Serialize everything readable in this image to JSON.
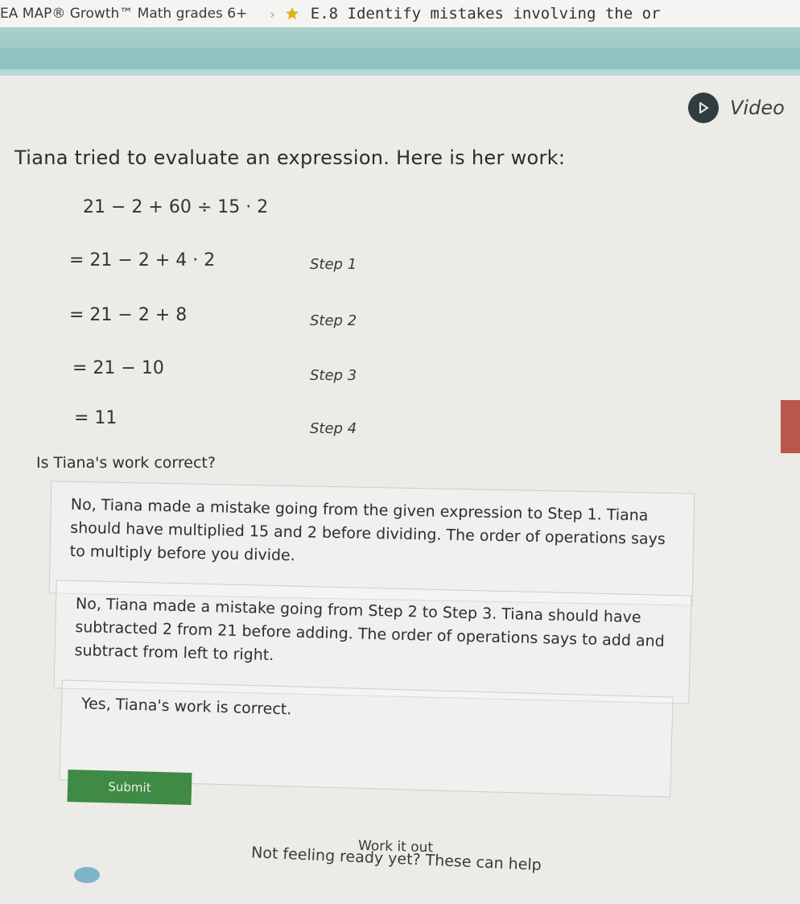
{
  "breadcrumb": {
    "item1": "EA MAP® Growth™ Math grades 6+",
    "separator": "›",
    "item2": "E.8 Identify mistakes involving the or"
  },
  "video": {
    "label": "Video"
  },
  "prompt": "Tiana tried to evaluate an expression. Here is her work:",
  "work": {
    "expression": "21 − 2 + 60 ÷ 15 · 2",
    "steps": [
      {
        "expr": "= 21 − 2 + 4 · 2",
        "label": "Step 1"
      },
      {
        "expr": "= 21 − 2 + 8",
        "label": "Step 2"
      },
      {
        "expr": "= 21 − 10",
        "label": "Step 3"
      },
      {
        "expr": "= 11",
        "label": "Step 4"
      }
    ]
  },
  "question": "Is Tiana's work correct?",
  "choices": [
    "No, Tiana made a mistake going from the given expression to Step 1. Tiana should have multiplied 15 and 2 before dividing. The order of operations says to multiply before you divide.",
    "No, Tiana made a mistake going from Step 2 to Step 3. Tiana should have subtracted 2 from 21 before adding. The order of operations says to add and subtract from left to right.",
    "Yes, Tiana's work is correct."
  ],
  "submit_label": "Submit",
  "work_it_out": {
    "title": "Work it out",
    "subtitle": "Not feeling ready yet? These can help"
  },
  "colors": {
    "teal": "#9fc9c8",
    "submit": "#3f8a44",
    "video_circle": "#2f3c40",
    "star": "#e0b31a"
  },
  "icons": [
    "star-icon",
    "play-icon",
    "help-icon"
  ]
}
